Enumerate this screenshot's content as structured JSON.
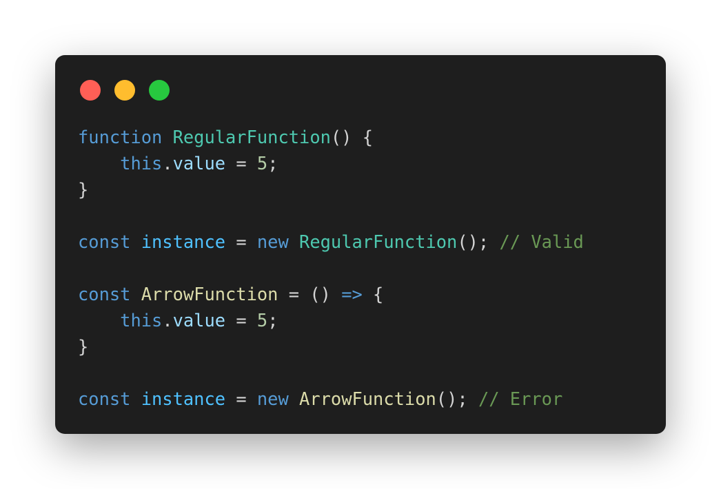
{
  "window": {
    "controls": [
      {
        "name": "close",
        "color": "#ff5f56"
      },
      {
        "name": "minimize",
        "color": "#ffbd2e"
      },
      {
        "name": "maximize",
        "color": "#27c93f"
      }
    ]
  },
  "code": {
    "lines": [
      [
        {
          "t": "function",
          "c": "keyword"
        },
        {
          "t": " ",
          "c": "plain"
        },
        {
          "t": "RegularFunction",
          "c": "class"
        },
        {
          "t": "() {",
          "c": "plain"
        }
      ],
      [
        {
          "t": "    ",
          "c": "plain"
        },
        {
          "t": "this",
          "c": "keyword"
        },
        {
          "t": ".",
          "c": "plain"
        },
        {
          "t": "value",
          "c": "var"
        },
        {
          "t": " = ",
          "c": "plain"
        },
        {
          "t": "5",
          "c": "number"
        },
        {
          "t": ";",
          "c": "plain"
        }
      ],
      [
        {
          "t": "}",
          "c": "plain"
        }
      ],
      [],
      [
        {
          "t": "const",
          "c": "keyword"
        },
        {
          "t": " ",
          "c": "plain"
        },
        {
          "t": "instance",
          "c": "const"
        },
        {
          "t": " = ",
          "c": "plain"
        },
        {
          "t": "new",
          "c": "keyword"
        },
        {
          "t": " ",
          "c": "plain"
        },
        {
          "t": "RegularFunction",
          "c": "class"
        },
        {
          "t": "(); ",
          "c": "plain"
        },
        {
          "t": "// Valid",
          "c": "comment"
        }
      ],
      [],
      [
        {
          "t": "const",
          "c": "keyword"
        },
        {
          "t": " ",
          "c": "plain"
        },
        {
          "t": "ArrowFunction",
          "c": "func"
        },
        {
          "t": " = () ",
          "c": "plain"
        },
        {
          "t": "=>",
          "c": "keyword"
        },
        {
          "t": " {",
          "c": "plain"
        }
      ],
      [
        {
          "t": "    ",
          "c": "plain"
        },
        {
          "t": "this",
          "c": "keyword"
        },
        {
          "t": ".",
          "c": "plain"
        },
        {
          "t": "value",
          "c": "var"
        },
        {
          "t": " = ",
          "c": "plain"
        },
        {
          "t": "5",
          "c": "number"
        },
        {
          "t": ";",
          "c": "plain"
        }
      ],
      [
        {
          "t": "}",
          "c": "plain"
        }
      ],
      [],
      [
        {
          "t": "const",
          "c": "keyword"
        },
        {
          "t": " ",
          "c": "plain"
        },
        {
          "t": "instance",
          "c": "const"
        },
        {
          "t": " = ",
          "c": "plain"
        },
        {
          "t": "new",
          "c": "keyword"
        },
        {
          "t": " ",
          "c": "plain"
        },
        {
          "t": "ArrowFunction",
          "c": "func"
        },
        {
          "t": "(); ",
          "c": "plain"
        },
        {
          "t": "// Error",
          "c": "comment"
        }
      ]
    ]
  }
}
